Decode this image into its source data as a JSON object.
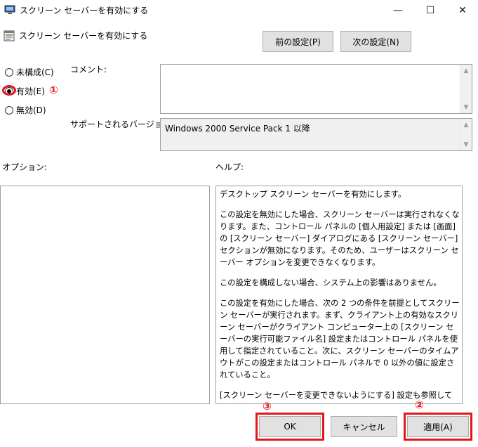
{
  "window": {
    "title": "スクリーン セーバーを有効にする",
    "minimize_glyph": "—",
    "maximize_glyph": "☐",
    "close_glyph": "✕"
  },
  "header": {
    "policy_title": "スクリーン セーバーを有効にする",
    "prev_button": "前の設定(P)",
    "next_button": "次の設定(N)"
  },
  "state": {
    "options": [
      {
        "label": "未構成(C)",
        "checked": false
      },
      {
        "label": "有効(E)",
        "checked": true
      },
      {
        "label": "無効(D)",
        "checked": false
      }
    ]
  },
  "comment": {
    "label": "コメント:",
    "value": ""
  },
  "supported": {
    "label": "サポートされるバージョン:",
    "value": "Windows 2000 Service Pack 1 以降"
  },
  "options_panel": {
    "label": "オプション:"
  },
  "help_panel": {
    "label": "ヘルプ:",
    "paragraphs": [
      "デスクトップ スクリーン セーバーを有効にします。",
      "この設定を無効にした場合、スクリーン セーバーは実行されなくなります。また、コントロール パネルの [個人用設定] または [画面] の [スクリーン セーバー] ダイアログにある [スクリーン セーバー] セクションが無効になります。そのため、ユーザーはスクリーン セーバー オプションを変更できなくなります。",
      "この設定を構成しない場合、システム上の影響はありません。",
      "この設定を有効にした場合、次の 2 つの条件を前提としてスクリーン セーバーが実行されます。まず、クライアント上の有効なスクリーン セーバーがクライアント コンピューター上の [スクリーン セーバーの実行可能ファイル名] 設定またはコントロール パネルを使用して指定されていること。次に、スクリーン セーバーのタイムアウトがこの設定またはコントロール パネルで 0 以外の値に設定されていること。",
      "[スクリーン セーバーを変更できないようにする] 設定も参照してください。"
    ]
  },
  "footer": {
    "ok_button": "OK",
    "cancel_button": "キャンセル",
    "apply_button": "適用(A)"
  },
  "annotations": {
    "mark_1": "①",
    "mark_2": "②",
    "mark_3": "③",
    "color": "#e3151d"
  }
}
